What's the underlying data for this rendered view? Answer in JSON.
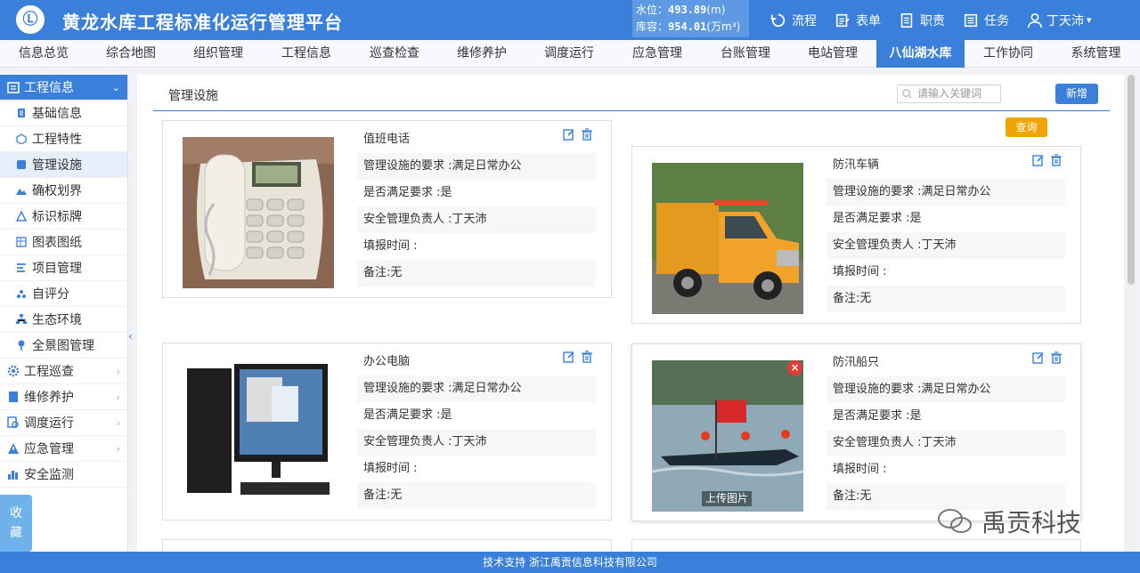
{
  "header": {
    "logo_char": "Ⓛ",
    "title": "黄龙水库工程标准化运行管理平台",
    "water_level_label": "水位：",
    "water_level_value": "493.89",
    "water_level_unit": "(m)",
    "capacity_label": "库容：",
    "capacity_value": "954.01",
    "capacity_unit": "(万m³)",
    "actions": [
      {
        "label": "流程",
        "icon": "process-icon"
      },
      {
        "label": "表单",
        "icon": "form-icon"
      },
      {
        "label": "职责",
        "icon": "duty-icon"
      },
      {
        "label": "任务",
        "icon": "task-icon"
      }
    ],
    "user_name": "丁天沛",
    "user_caret": "▾"
  },
  "nav": {
    "items": [
      "信息总览",
      "综合地图",
      "组织管理",
      "工程信息",
      "巡查检查",
      "维修养护",
      "调度运行",
      "应急管理",
      "台账管理",
      "电站管理",
      "八仙湖水库",
      "工作协同",
      "系统管理"
    ],
    "active_index": 10
  },
  "sidebar": {
    "group_title": "工程信息",
    "items": [
      "基础信息",
      "工程特性",
      "管理设施",
      "确权划界",
      "标识标牌",
      "图表图纸",
      "项目管理",
      "自评分",
      "生态环境",
      "全景图管理"
    ],
    "active_item": 2,
    "groups": [
      "工程巡查",
      "维修养护",
      "调度运行",
      "应急管理",
      "安全监测"
    ],
    "collapse_arrow": "‹",
    "favorites_label_1": "收",
    "favorites_label_2": "藏"
  },
  "main": {
    "section_title": "管理设施",
    "search_placeholder": "请输入关键词",
    "add_label": "新增",
    "query_label": "查询",
    "upload_label": "上传图片",
    "close_mark": "×",
    "cards": [
      {
        "name": "值班电话",
        "req": "管理设施的要求 :满足日常办公",
        "meet": "是否满足要求 :是",
        "owner": "安全管理负责人 :丁天沛",
        "time": "填报时间 :",
        "note": "备注:无"
      },
      {
        "name": "防汛车辆",
        "req": "管理设施的要求 :满足日常办公",
        "meet": "是否满足要求 :是",
        "owner": "安全管理负责人 :丁天沛",
        "time": "填报时间 :",
        "note": "备注:无"
      },
      {
        "name": "办公电脑",
        "req": "管理设施的要求 :满足日常办公",
        "meet": "是否满足要求 :是",
        "owner": "安全管理负责人 :丁天沛",
        "time": "填报时间 :",
        "note": "备注:无"
      },
      {
        "name": "防汛船只",
        "req": "管理设施的要求 :满足日常办公",
        "meet": "是否满足要求 :是",
        "owner": "安全管理负责人 :丁天沛",
        "time": "填报时间 :",
        "note": "备注:无"
      }
    ]
  },
  "footer": {
    "text": "技术支持 浙江禹贡信息科技有限公司"
  },
  "watermark": {
    "text": "禹贡科技"
  },
  "colors": {
    "primary": "#3a80db",
    "query": "#f0a500",
    "close": "#e53935"
  }
}
